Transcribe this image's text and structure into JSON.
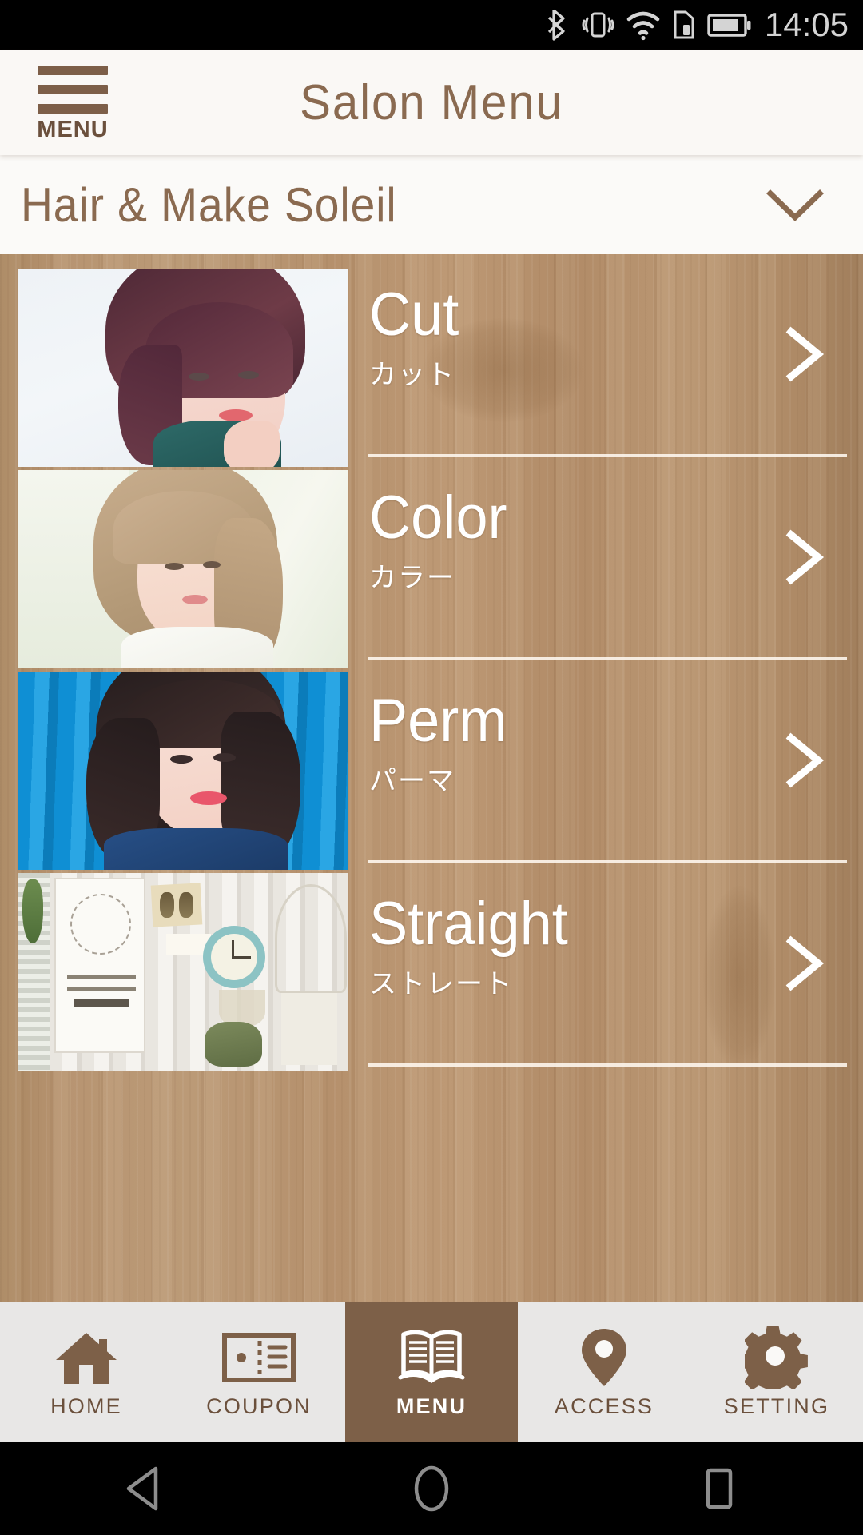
{
  "statusbar": {
    "time": "14:05",
    "icons": [
      "bluetooth-icon",
      "vibrate-icon",
      "wifi-icon",
      "sim-card-icon",
      "battery-icon"
    ]
  },
  "header": {
    "menu_button_label": "MENU",
    "title": "Salon Menu",
    "menu_icon": "hamburger-icon"
  },
  "salon_selector": {
    "name": "Hair & Make Soleil",
    "chevron_icon": "chevron-down-icon"
  },
  "menu_items": [
    {
      "title": "Cut",
      "subtitle": "カット",
      "arrow_icon": "chevron-right-icon",
      "thumb": "short-bob-hairstyle-photo"
    },
    {
      "title": "Color",
      "subtitle": "カラー",
      "arrow_icon": "chevron-right-icon",
      "thumb": "ash-beige-hairstyle-photo"
    },
    {
      "title": "Perm",
      "subtitle": "パーマ",
      "arrow_icon": "chevron-right-icon",
      "thumb": "wavy-perm-blue-wall-photo"
    },
    {
      "title": "Straight",
      "subtitle": "ストレート",
      "arrow_icon": "chevron-right-icon",
      "thumb": "salon-interior-decor-photo"
    }
  ],
  "tabbar": {
    "active": "MENU",
    "items": [
      {
        "label": "HOME",
        "icon": "home-icon",
        "active": false
      },
      {
        "label": "COUPON",
        "icon": "ticket-icon",
        "active": false
      },
      {
        "label": "MENU",
        "icon": "book-icon",
        "active": true
      },
      {
        "label": "ACCESS",
        "icon": "map-pin-icon",
        "active": false
      },
      {
        "label": "SETTING",
        "icon": "gear-icon",
        "active": false
      }
    ]
  },
  "android_nav": {
    "back": "back-triangle-icon",
    "home": "home-circle-icon",
    "recents": "recents-square-icon"
  },
  "colors": {
    "brand_brown": "#7d5f48",
    "title_brown": "#8a6a50",
    "wood": "#b5926f",
    "active_tab": "#7d6048",
    "panel": "#faf8f5"
  }
}
